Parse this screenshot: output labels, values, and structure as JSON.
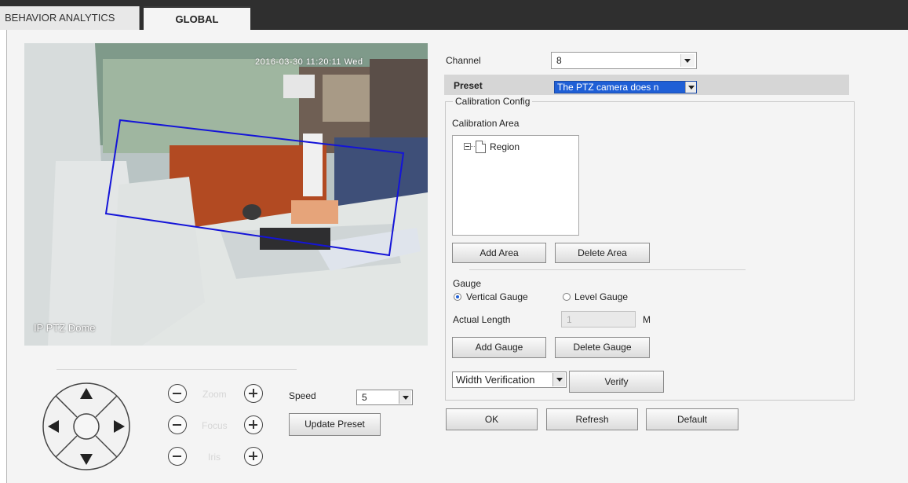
{
  "tabs": [
    {
      "label": "BEHAVIOR ANALYTICS"
    },
    {
      "label": "GLOBAL"
    }
  ],
  "video": {
    "timestamp": "2016-03-30 11:20:11 Wed",
    "label": "IP PTZ Dome"
  },
  "ptz": {
    "zoom_label": "Zoom",
    "focus_label": "Focus",
    "iris_label": "Iris",
    "speed_label": "Speed",
    "speed_value": "5",
    "update_preset_label": "Update Preset"
  },
  "form": {
    "channel_label": "Channel",
    "channel_value": "8",
    "preset_label": "Preset",
    "preset_value": "The PTZ camera does n",
    "calibration_legend": "Calibration Config",
    "calibration_area_label": "Calibration Area",
    "tree_item": "Region",
    "add_area_label": "Add Area",
    "delete_area_label": "Delete Area",
    "gauge_label": "Gauge",
    "vertical_gauge_label": "Vertical Gauge",
    "level_gauge_label": "Level Gauge",
    "actual_length_label": "Actual Length",
    "actual_length_value": "1",
    "unit": "M",
    "add_gauge_label": "Add Gauge",
    "delete_gauge_label": "Delete Gauge",
    "width_verification_value": "Width Verification",
    "verify_label": "Verify"
  },
  "actions": {
    "ok_label": "OK",
    "refresh_label": "Refresh",
    "default_label": "Default"
  },
  "colors": {
    "tab_bar": "#2f2f2f",
    "panel_bg": "#f4f4f4",
    "selection_blue": "#1f5fd6",
    "roi_blue": "#1414d8"
  }
}
